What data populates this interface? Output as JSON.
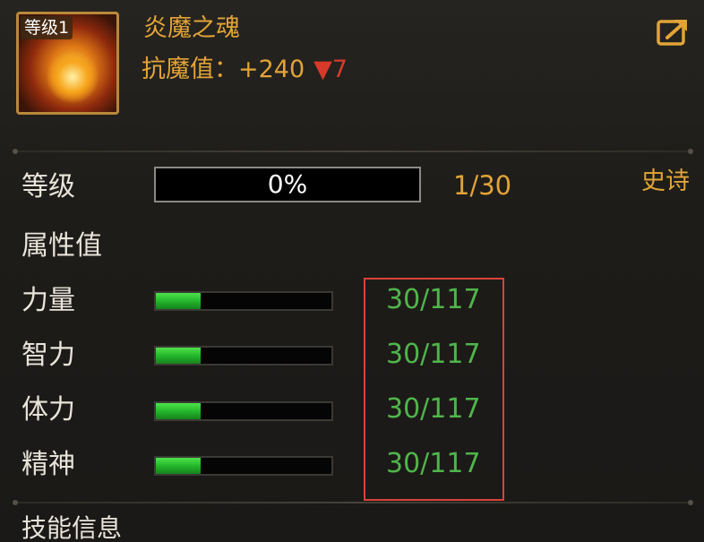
{
  "header": {
    "level_badge": "等级1",
    "name": "炎魔之魂",
    "resist_label": "抗魔值：",
    "resist_value": "+240",
    "resist_change": "▼7",
    "export_icon": "export-arrow-icon"
  },
  "level": {
    "label": "等级",
    "progress_text": "0%",
    "progress_fraction": 0,
    "count": "1/30",
    "rarity": "史诗"
  },
  "attributes": {
    "heading": "属性值",
    "items": [
      {
        "label": "力量",
        "value": "30/117",
        "fraction": 0.2564
      },
      {
        "label": "智力",
        "value": "30/117",
        "fraction": 0.2564
      },
      {
        "label": "体力",
        "value": "30/117",
        "fraction": 0.2564
      },
      {
        "label": "精神",
        "value": "30/117",
        "fraction": 0.2564
      }
    ]
  },
  "skills": {
    "heading": "技能信息"
  },
  "colors": {
    "gold": "#e2a436",
    "green": "#4fb54a",
    "red_highlight": "#d9423a",
    "decrease_red": "#d83a2a"
  }
}
